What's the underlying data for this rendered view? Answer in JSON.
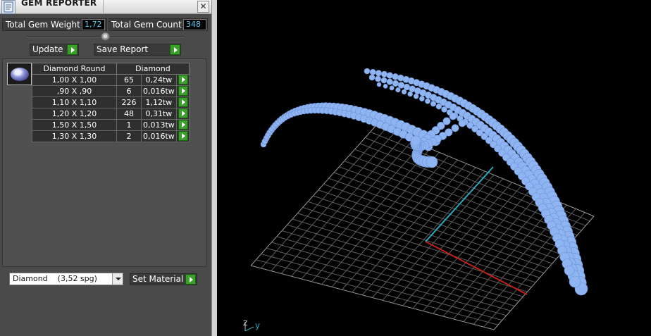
{
  "window": {
    "title": "GEM REPORTER",
    "close_glyph": "✕"
  },
  "summary": {
    "weight_label": "Total Gem Weight",
    "weight_value": "1,72",
    "count_label": "Total Gem Count",
    "count_value": "348"
  },
  "buttons": {
    "update": "Update",
    "save_report": "Save Report",
    "set_material": "Set Material"
  },
  "table": {
    "headers": [
      "Diamond Round",
      "Diamond"
    ],
    "rows": [
      {
        "size": "1,00 X 1,00",
        "count": "65",
        "weight": "0,24tw"
      },
      {
        "size": ",90 X ,90",
        "count": "6",
        "weight": "0,016tw"
      },
      {
        "size": "1,10 X 1,10",
        "count": "226",
        "weight": "1,12tw"
      },
      {
        "size": "1,20 X 1,20",
        "count": "48",
        "weight": "0,31tw"
      },
      {
        "size": "1,50 X 1,50",
        "count": "1",
        "weight": "0,013tw"
      },
      {
        "size": "1,30 X 1,30",
        "count": "2",
        "weight": "0,016tw"
      }
    ]
  },
  "material": {
    "selected": "Diamond    (3,52 spg)"
  },
  "viewport": {
    "axis_labels": {
      "z": "z",
      "y": "y"
    },
    "gem_color": "#8fb4f2",
    "x_axis_color": "#c0201a",
    "y_axis_color": "#2aa8c0"
  },
  "icons": {
    "app": "gem-reporter-icon",
    "close": "close-icon",
    "run": "green-play-icon",
    "gem_thumb": "round-diamond-icon"
  }
}
